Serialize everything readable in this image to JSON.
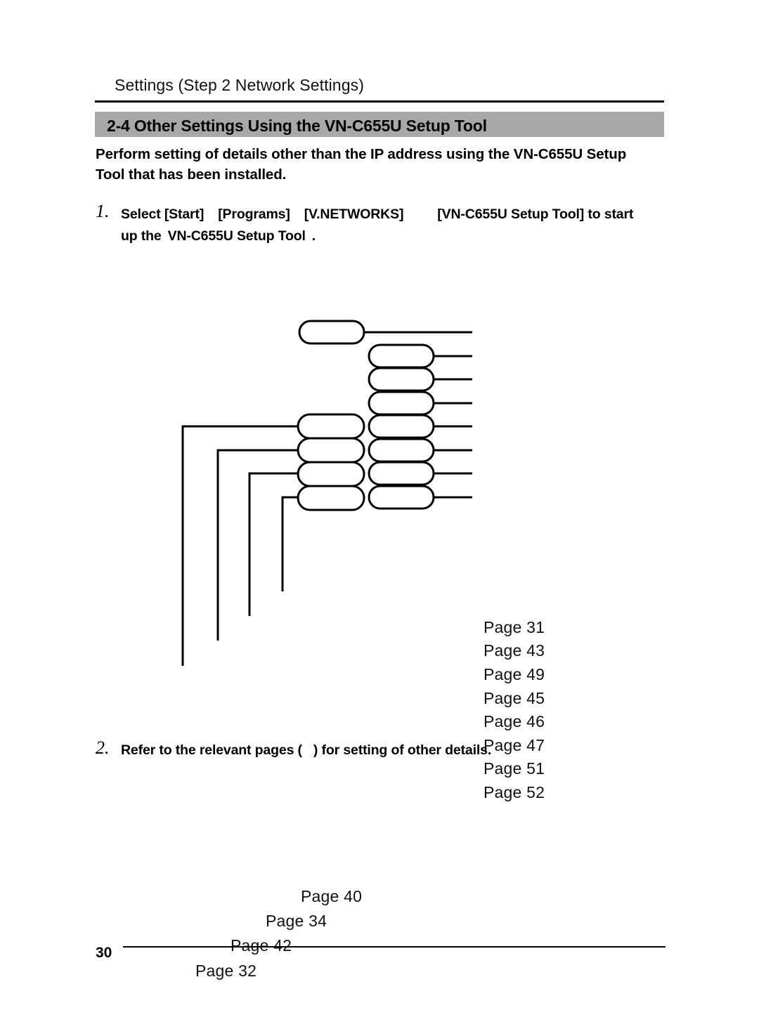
{
  "document": {
    "running_head": "Settings (Step 2 Network Settings)",
    "section_number_title": "2-4 Other Settings Using the  VN-C655U Setup Tool",
    "intro_text": "Perform setting of details other than the IP address using the  VN-C655U Setup",
    "intro_text_line2": "Tool  that has been installed.",
    "folio": "30"
  },
  "steps": [
    {
      "number": "1.",
      "seg_select": "Select [Start]",
      "seg_programs": "[Programs]",
      "seg_vnetworks": "[V.NETWORKS]",
      "seg_tool": "[VN-C655U Setup Tool] to start",
      "line2_a": "up the",
      "line2_b": "VN-C655U Setup Tool",
      "line2_c": "."
    },
    {
      "number": "2.",
      "text_a": "Refer to the relevant pages (",
      "text_b": ") for setting of other details."
    }
  ],
  "diagram": {
    "column1": [
      {
        "id": "c1-box-1",
        "label": ""
      },
      {
        "id": "c1-box-2",
        "label": ""
      },
      {
        "id": "c1-box-3",
        "label": ""
      },
      {
        "id": "c1-box-4",
        "label": ""
      },
      {
        "id": "c1-box-5",
        "label": ""
      }
    ],
    "column2": [
      {
        "id": "c2-box-1",
        "label": ""
      },
      {
        "id": "c2-box-2",
        "label": ""
      },
      {
        "id": "c2-box-3",
        "label": ""
      },
      {
        "id": "c2-box-4",
        "label": ""
      },
      {
        "id": "c2-box-5",
        "label": ""
      },
      {
        "id": "c2-box-6",
        "label": ""
      },
      {
        "id": "c2-box-7",
        "label": ""
      }
    ],
    "right_page_refs": [
      "Page 31",
      "Page 43",
      "Page 49",
      "Page 45",
      "Page 46",
      "Page 47",
      "Page 51",
      "Page 52"
    ],
    "lower_page_refs": [
      "Page 40",
      "Page 34",
      "Page 42",
      "Page 32"
    ]
  },
  "colors": {
    "band_gray": "#a8a8a8",
    "ink": "#000000",
    "paper": "#ffffff"
  }
}
